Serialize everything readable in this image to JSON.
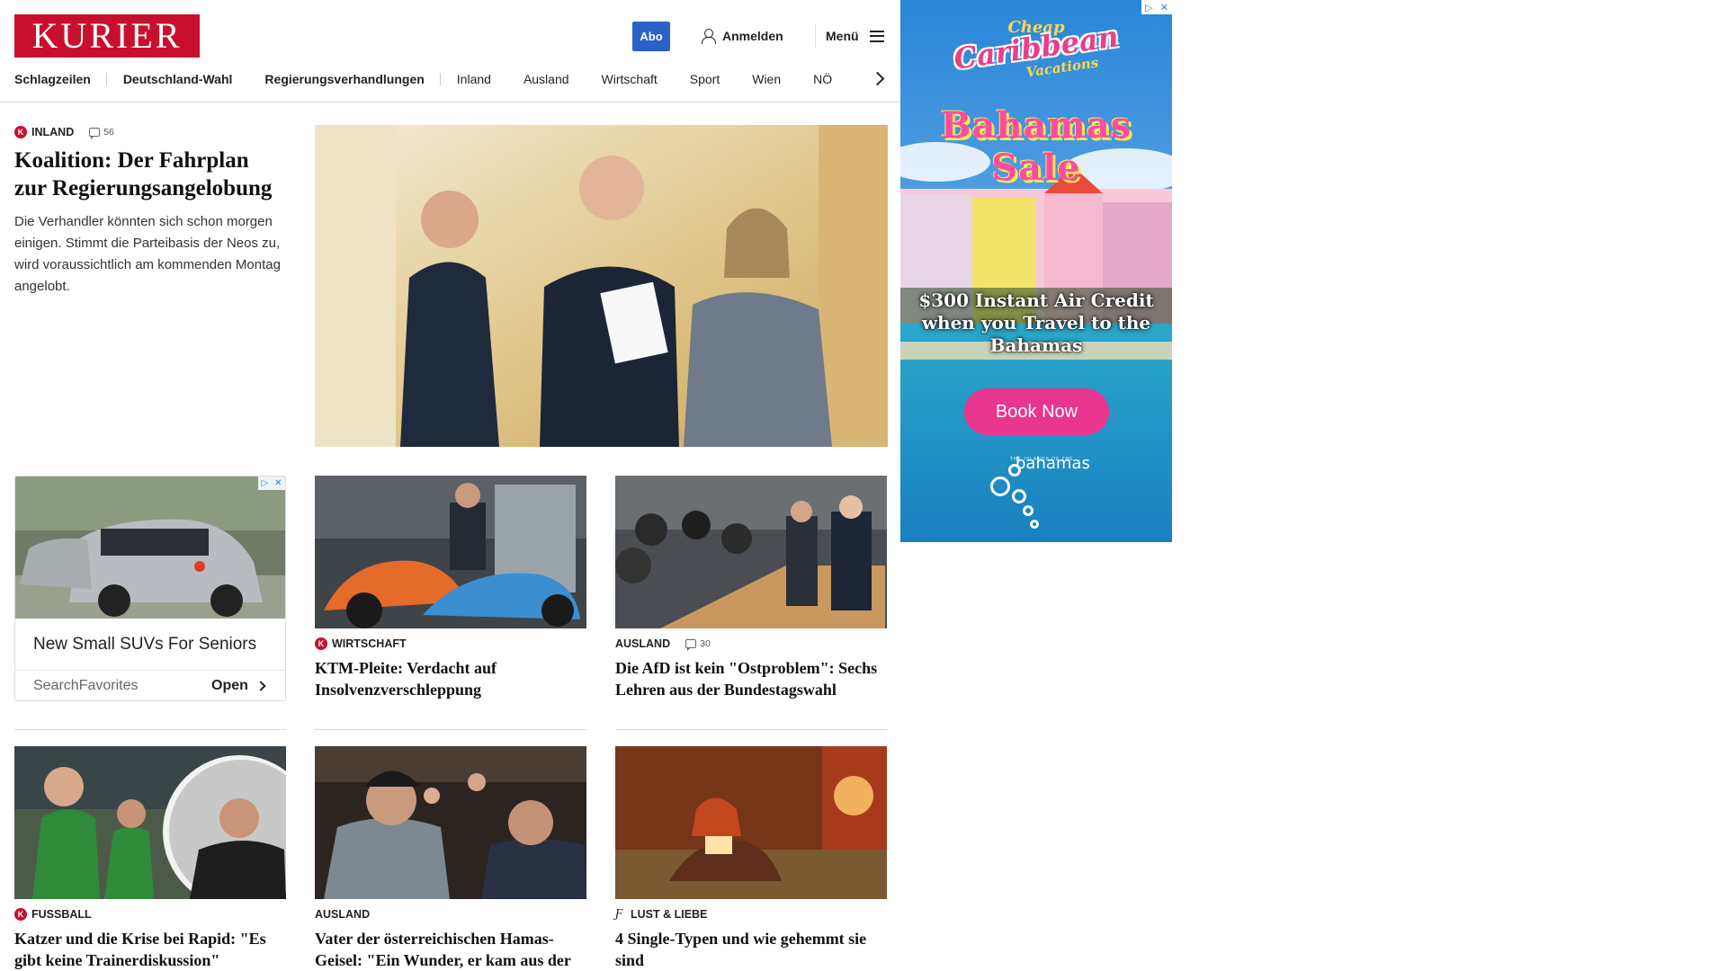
{
  "header": {
    "logo_text": "KURIER",
    "abo_label": "Abo",
    "login_label": "Anmelden",
    "menu_label": "Menü"
  },
  "nav": {
    "items": [
      "Schlagzeilen",
      "Deutschland-Wahl",
      "Regierungsverhandlungen",
      "Inland",
      "Ausland",
      "Wirtschaft",
      "Sport",
      "Wien",
      "NÖ"
    ]
  },
  "lead": {
    "badge": "K",
    "section": "Inland",
    "comments": "56",
    "title": "Koalition: Der Fahrplan zur Regierungsangelobung",
    "teaser": "Die Verhandler könnten sich schon morgen einigen. Stimmt die Parteibasis der Neos zu, wird voraussichtlich am kommenden Montag angelobt."
  },
  "native_ad": {
    "title": "New Small SUVs For Seniors",
    "source": "SearchFavorites",
    "cta": "Open"
  },
  "articles": [
    {
      "badge": "K",
      "section": "Wirtschaft",
      "comments": "",
      "title": "KTM-Pleite: Verdacht auf Insolvenzverschleppung"
    },
    {
      "badge": "",
      "section": "Ausland",
      "comments": "30",
      "title": "Die AfD ist kein \"Ostproblem\": Sechs Lehren aus der Bundestagswahl"
    },
    {
      "badge": "K",
      "section": "Fussball",
      "comments": "",
      "title": "Katzer und die Krise bei Rapid: \"Es gibt keine Trainerdiskussion\""
    },
    {
      "badge": "",
      "section": "Ausland",
      "comments": "",
      "title": "Vater der österreichischen Hamas-Geisel: \"Ein Wunder, er kam aus der Hölle\""
    },
    {
      "badge": "",
      "section": "Lust & Liebe",
      "comments": "",
      "title": "4 Single-Typen und wie gehemmt sie sind"
    }
  ],
  "banner_ad": {
    "line1": "Cheap",
    "line2": "Caribbean",
    "line3": "Vacations",
    "headline": "Bahamas Sale",
    "offer": "$300 Instant Air Credit when you Travel to the Bahamas",
    "cta": "Book Now",
    "brand": "bahamas",
    "brand_tagline": "THE ISLANDS OF THE"
  },
  "colors": {
    "brand_red": "#c8102e",
    "abo_blue": "#2a62c9",
    "ad_pink": "#e8368f"
  }
}
